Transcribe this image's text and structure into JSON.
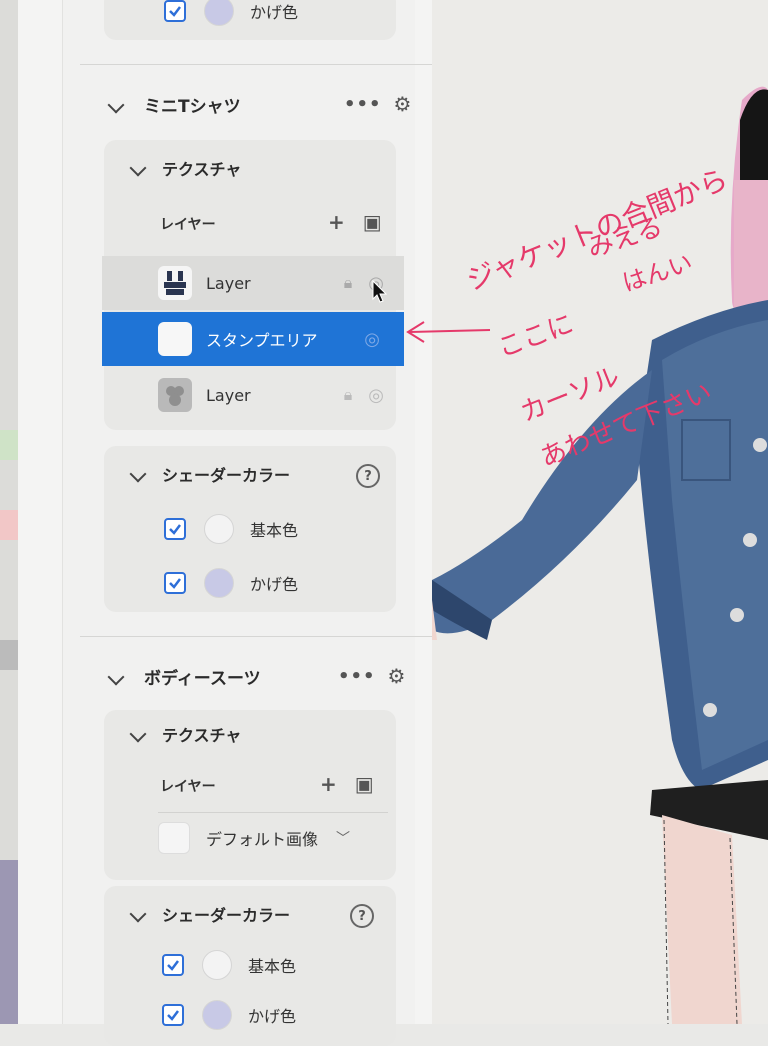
{
  "section_top": {
    "swatch_label": "かげ色"
  },
  "mini_tshirt": {
    "title": "ミニTシャツ",
    "texture": {
      "title": "テクスチャ",
      "layers_label": "レイヤー",
      "layers": [
        {
          "name": "Layer",
          "selected": false
        },
        {
          "name": "スタンプエリア",
          "selected": true
        },
        {
          "name": "Layer",
          "selected": false
        }
      ]
    },
    "shader": {
      "title": "シェーダーカラー",
      "items": [
        {
          "label": "基本色",
          "color": "#f3f3f3"
        },
        {
          "label": "かげ色",
          "color": "#c8c9e6"
        }
      ]
    }
  },
  "bodysuit": {
    "title": "ボディースーツ",
    "texture": {
      "title": "テクスチャ",
      "layers_label": "レイヤー",
      "default_image": "デフォルト画像"
    },
    "shader": {
      "title": "シェーダーカラー",
      "items": [
        {
          "label": "基本色",
          "color": "#f3f3f3"
        },
        {
          "label": "かげ色",
          "color": "#c8c9e6"
        }
      ]
    }
  },
  "annotations": {
    "line1": "ジャケットの合間から",
    "line2": "みえる",
    "line3": "はんい",
    "line4": "ここに",
    "line5": "カーソル",
    "line6": "あわせて下さい"
  },
  "colors": {
    "accent": "#1f74d6",
    "annotation": "#e5396a"
  }
}
